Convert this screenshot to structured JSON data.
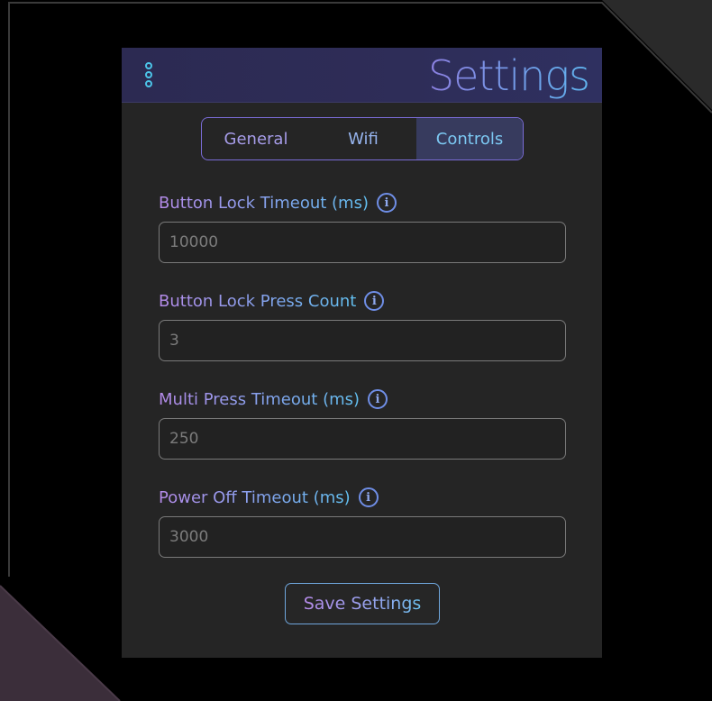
{
  "app": {
    "title": "Settings",
    "accent_colors": [
      "#b58ae8",
      "#62c0f0"
    ],
    "header_background": "#2e2d58",
    "panel_background": "#252525"
  },
  "header": {
    "menu_icon": "vertical-dots-menu-icon",
    "title": "Settings"
  },
  "tabs": [
    {
      "label": "General",
      "active": false
    },
    {
      "label": "Wifi",
      "active": false
    },
    {
      "label": "Controls",
      "active": true
    }
  ],
  "fields": [
    {
      "label": "Button Lock Timeout (ms)",
      "value": "10000",
      "icon": "info-icon"
    },
    {
      "label": "Button Lock Press Count",
      "value": "3",
      "icon": "info-icon"
    },
    {
      "label": "Multi Press Timeout (ms)",
      "value": "250",
      "icon": "info-icon"
    },
    {
      "label": "Power Off Timeout (ms)",
      "value": "3000",
      "icon": "info-icon"
    }
  ],
  "actions": {
    "save_label": "Save Settings"
  },
  "info_glyph": "i"
}
